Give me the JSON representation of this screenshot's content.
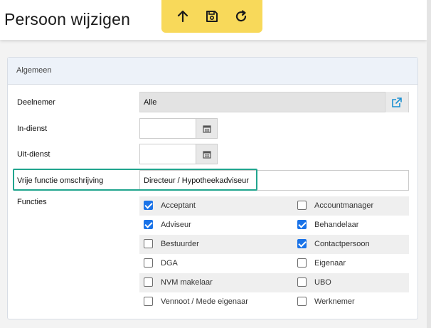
{
  "header": {
    "title": "Persoon wijzigen",
    "toolbar": [
      {
        "icon": "arrow-up-icon",
        "name": "up-button"
      },
      {
        "icon": "save-icon",
        "name": "save-button"
      },
      {
        "icon": "refresh-icon",
        "name": "refresh-button"
      }
    ]
  },
  "panel": {
    "title": "Algemeen",
    "fields": {
      "deelnemer": {
        "label": "Deelnemer",
        "value": "Alle"
      },
      "in_dienst": {
        "label": "In-dienst",
        "value": ""
      },
      "uit_dienst": {
        "label": "Uit-dienst",
        "value": ""
      },
      "vrije_functie": {
        "label": "Vrije functie omschrijving",
        "value": "Directeur / Hypotheekadviseur"
      }
    },
    "functies": {
      "label": "Functies",
      "items": [
        {
          "label": "Acceptant",
          "checked": true
        },
        {
          "label": "Accountmanager",
          "checked": false
        },
        {
          "label": "Adviseur",
          "checked": true
        },
        {
          "label": "Behandelaar",
          "checked": true
        },
        {
          "label": "Bestuurder",
          "checked": false
        },
        {
          "label": "Contactpersoon",
          "checked": true
        },
        {
          "label": "DGA",
          "checked": false
        },
        {
          "label": "Eigenaar",
          "checked": false
        },
        {
          "label": "NVM makelaar",
          "checked": false
        },
        {
          "label": "UBO",
          "checked": false
        },
        {
          "label": "Vennoot / Mede eigenaar",
          "checked": false
        },
        {
          "label": "Werknemer",
          "checked": false
        }
      ]
    }
  },
  "colors": {
    "toolbar": "#f8d95a",
    "checkbox_checked": "#1a73e8",
    "highlight": "#21a58e",
    "external_link": "#1a8fd1"
  }
}
